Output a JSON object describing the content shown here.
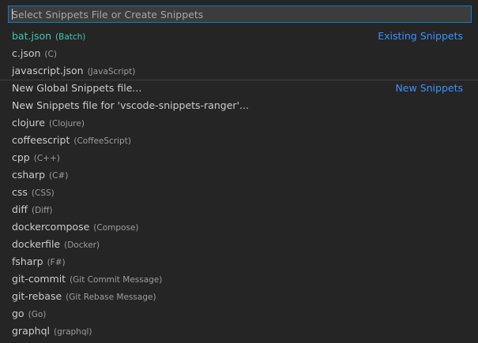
{
  "quick_pick": {
    "placeholder": "Select Snippets File or Create Snippets",
    "value": ""
  },
  "groups": {
    "existing": "Existing Snippets",
    "new": "New Snippets"
  },
  "existing_items": [
    {
      "label": "bat.json",
      "description": "(Batch)"
    },
    {
      "label": "c.json",
      "description": "(C)"
    },
    {
      "label": "javascript.json",
      "description": "(JavaScript)"
    }
  ],
  "new_items": [
    {
      "label": "New Global Snippets file...",
      "description": ""
    },
    {
      "label": "New Snippets file for 'vscode-snippets-ranger'...",
      "description": ""
    }
  ],
  "language_items": [
    {
      "label": "clojure",
      "description": "(Clojure)"
    },
    {
      "label": "coffeescript",
      "description": "(CoffeeScript)"
    },
    {
      "label": "cpp",
      "description": "(C++)"
    },
    {
      "label": "csharp",
      "description": "(C#)"
    },
    {
      "label": "css",
      "description": "(CSS)"
    },
    {
      "label": "diff",
      "description": "(Diff)"
    },
    {
      "label": "dockercompose",
      "description": "(Compose)"
    },
    {
      "label": "dockerfile",
      "description": "(Docker)"
    },
    {
      "label": "fsharp",
      "description": "(F#)"
    },
    {
      "label": "git-commit",
      "description": "(Git Commit Message)"
    },
    {
      "label": "git-rebase",
      "description": "(Git Rebase Message)"
    },
    {
      "label": "go",
      "description": "(Go)"
    },
    {
      "label": "graphql",
      "description": "(graphql)"
    }
  ],
  "colors": {
    "background": "#252526",
    "input_border": "#007fd4",
    "active_label": "#3dc9b0",
    "group_label": "#3794ff",
    "description": "#9d9d9d"
  }
}
